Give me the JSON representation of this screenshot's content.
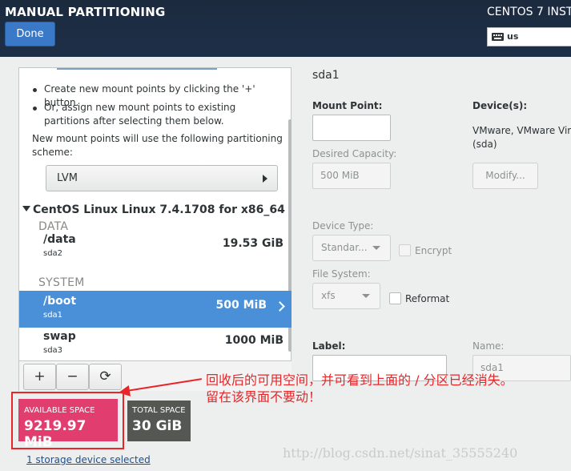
{
  "header": {
    "title": "MANUAL PARTITIONING",
    "done_label": "Done",
    "product": "CENTOS 7 INST",
    "keyboard_layout": "us"
  },
  "left": {
    "instructions": [
      "Create new mount points by clicking the '+' button.",
      "Or, assign new mount points to existing partitions after selecting them below."
    ],
    "scheme_text": "New mount points will use the following partitioning scheme:",
    "scheme_value": "LVM",
    "system_title": "CentOS Linux Linux 7.4.1708 for x86_64",
    "groups": {
      "data": "DATA",
      "system": "SYSTEM"
    },
    "mounts": [
      {
        "mount": "/data",
        "device": "sda2",
        "size": "19.53 GiB",
        "selected": false
      },
      {
        "mount": "/boot",
        "device": "sda1",
        "size": "500 MiB",
        "selected": true
      },
      {
        "mount": "swap",
        "device": "sda3",
        "size": "1000 MiB",
        "selected": false
      }
    ],
    "toolbar": {
      "add": "+",
      "remove": "−",
      "refresh": "⟳"
    }
  },
  "right": {
    "heading": "sda1",
    "mount_point_label": "Mount Point:",
    "mount_point_value": "",
    "desired_capacity_label": "Desired Capacity:",
    "desired_capacity_value": "500 MiB",
    "devices_label": "Device(s):",
    "devices_text_line1": "VMware, VMware Virt",
    "devices_text_line2": "(sda)",
    "modify_label": "Modify...",
    "device_type_label": "Device Type:",
    "device_type_value": "Standar...",
    "encrypt_label": "Encrypt",
    "file_system_label": "File System:",
    "file_system_value": "xfs",
    "reformat_label": "Reformat",
    "label_label": "Label:",
    "name_label": "Name:",
    "name_value": "sda1"
  },
  "footer": {
    "available_label": "AVAILABLE SPACE",
    "available_value": "9219.97 MiB",
    "total_label": "TOTAL SPACE",
    "total_value": "30 GiB",
    "device_link": "1 storage device selected"
  },
  "annotation": {
    "line1": "回收后的可用空间，并可看到上面的 / 分区已经消失。",
    "line2": "留在该界面不要动！",
    "color": "#e8262a"
  },
  "watermark": "http://blog.csdn.net/sinat_35555240",
  "colors": {
    "header_bg": "#1d2f48",
    "selection": "#4a90d9",
    "available": "#e13e6f",
    "total": "#555753",
    "done_button": "#3a79c7"
  }
}
